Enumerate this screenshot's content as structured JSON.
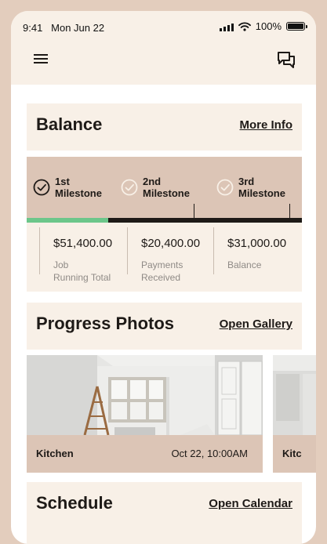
{
  "status_bar": {
    "time": "9:41",
    "date": "Mon Jun 22",
    "battery": "100%"
  },
  "header": {
    "menu_icon": "hamburger-menu-icon",
    "chat_icon": "chat-bubbles-icon"
  },
  "balance": {
    "title": "Balance",
    "link": "More Info",
    "milestones": [
      {
        "label": "1st\nMilestone",
        "completed": true
      },
      {
        "label": "2nd\nMilestone",
        "completed": false
      },
      {
        "label": "3rd\nMilestone",
        "completed": false
      }
    ],
    "progress_fraction": 0.295,
    "stats": [
      {
        "value": "$51,400.00",
        "label": "Job\nRunning Total"
      },
      {
        "value": "$20,400.00",
        "label": "Payments\nReceived"
      },
      {
        "value": "$31,000.00",
        "label": "Balance"
      }
    ]
  },
  "progress_photos": {
    "title": "Progress Photos",
    "link": "Open Gallery",
    "photos": [
      {
        "caption": "Kitchen",
        "date": "Oct 22, 10:00AM"
      },
      {
        "caption": "Kitc"
      }
    ]
  },
  "schedule": {
    "title": "Schedule",
    "link": "Open Calendar"
  },
  "colors": {
    "background": "#e3cdbd",
    "card": "#f8f0e7",
    "accent_band": "#dcc5b6",
    "progress_done": "#6cc68a",
    "progress_track": "#1e1a17"
  }
}
